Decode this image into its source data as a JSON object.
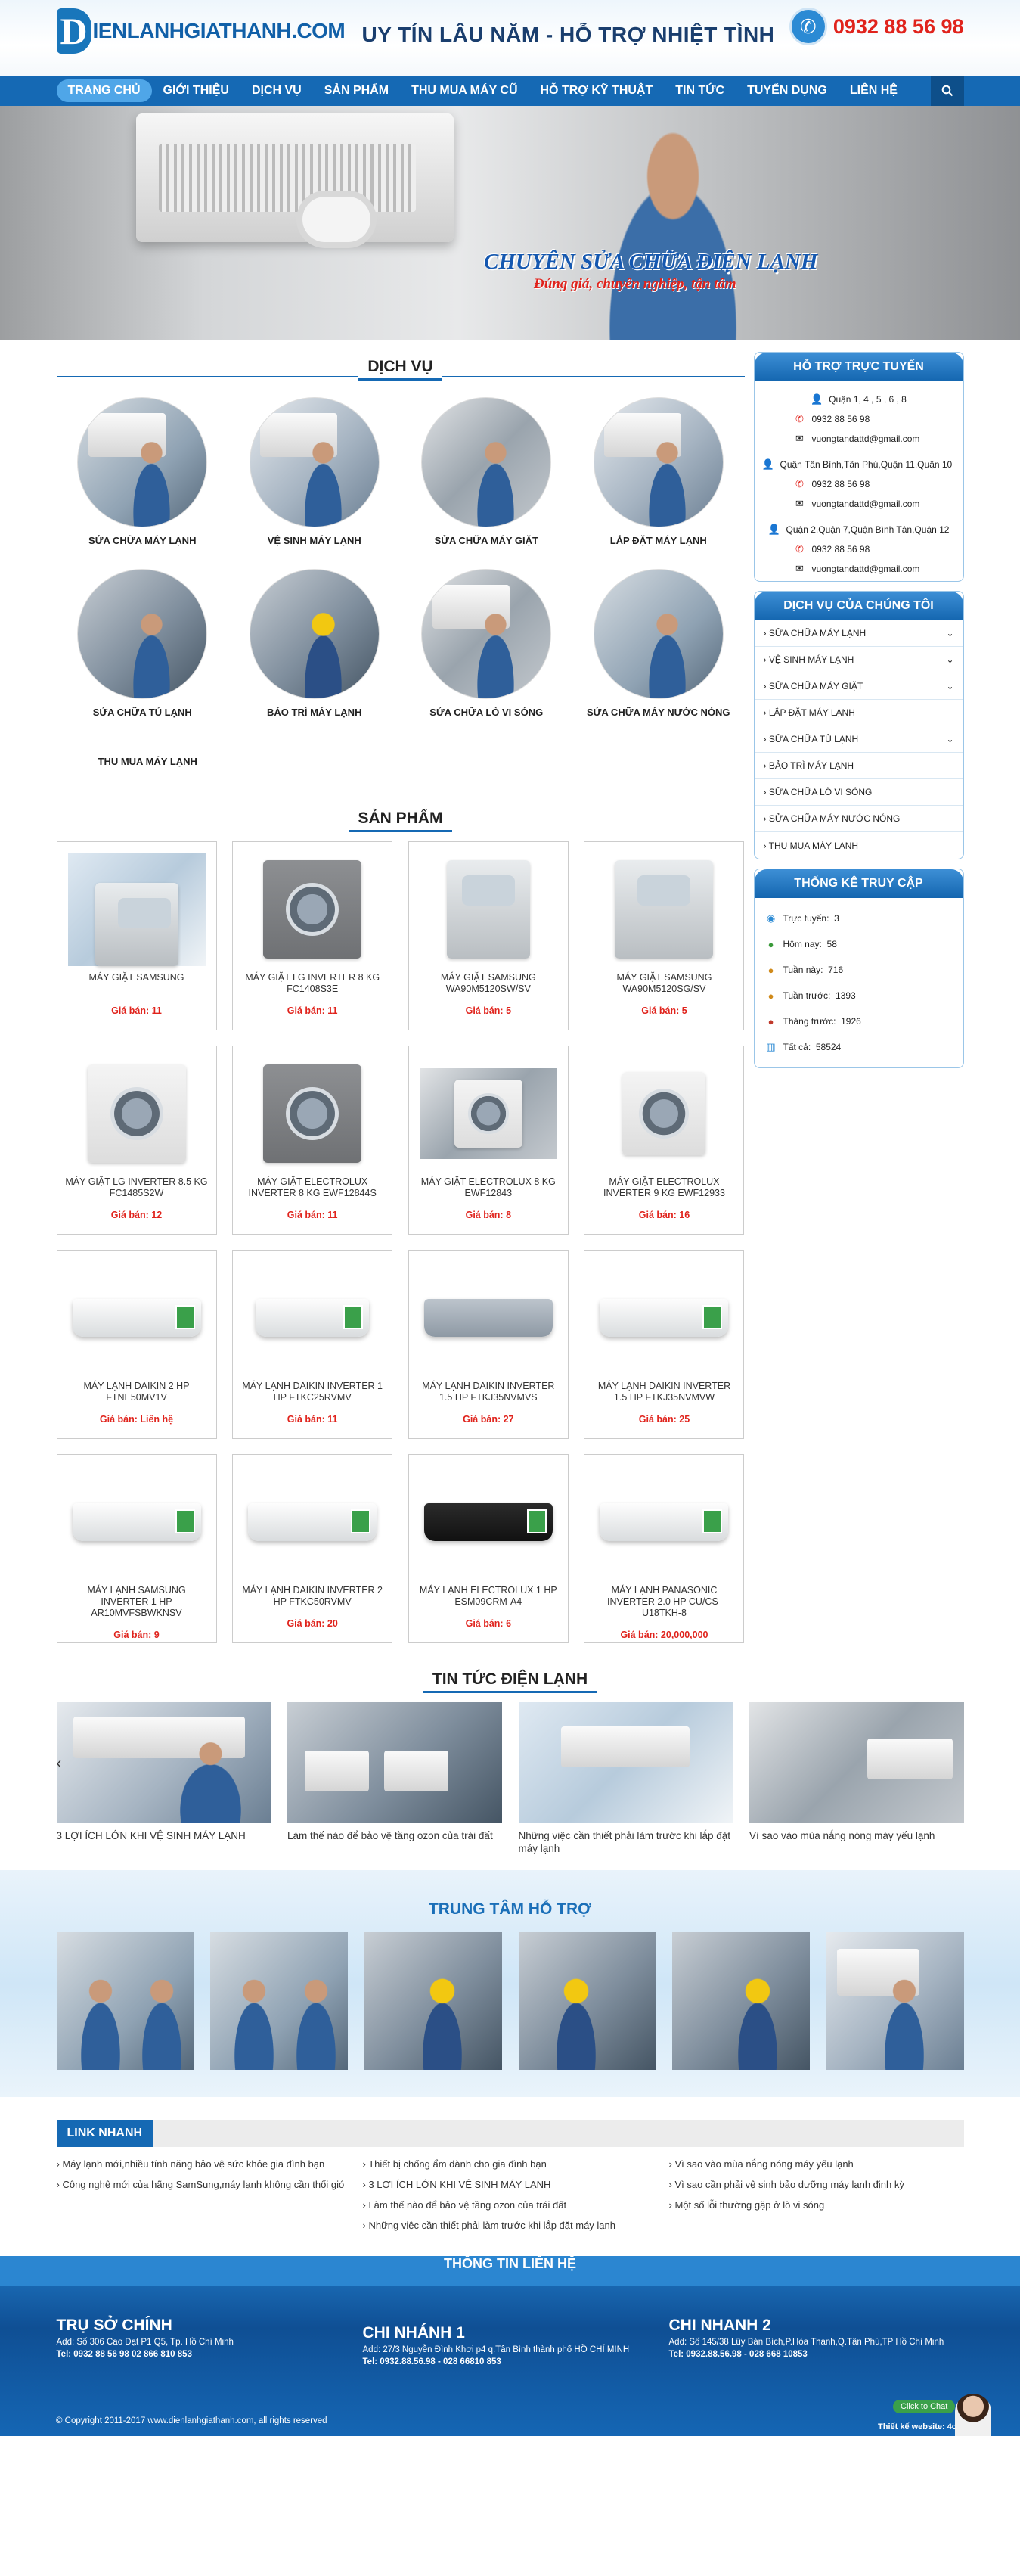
{
  "header": {
    "logo_letter": "D",
    "logo_text": "IENLANHGIATHANH.COM",
    "slogan": "UY TÍN LÂU NĂM - HỖ TRỢ NHIỆT TÌNH",
    "hotline": "0932 88 56 98"
  },
  "nav": {
    "items": [
      "TRANG CHỦ",
      "GIỚI THIỆU",
      "DỊCH VỤ",
      "SẢN PHẨM",
      "THU MUA MÁY CŨ",
      "HỖ TRỢ KỸ THUẬT",
      "TIN TỨC",
      "TUYỂN DỤNG",
      "LIÊN HỆ"
    ]
  },
  "banner": {
    "title": "CHUYÊN SỬA CHỮA ĐIỆN LẠNH",
    "subtitle": "Đúng giá, chuyên nghiệp, tận tâm"
  },
  "services": {
    "title": "DỊCH VỤ",
    "items": [
      "SỬA CHỮA MÁY LẠNH",
      "VỆ SINH MÁY LẠNH",
      "SỬA CHỮA MÁY GIẶT",
      "LẮP ĐẶT MÁY LẠNH",
      "SỬA CHỮA TỦ LẠNH",
      "BẢO TRÌ MÁY LẠNH",
      "SỬA CHỮA LÒ VI SÓNG",
      "SỬA CHỮA MÁY NƯỚC NÓNG"
    ],
    "extra": "THU MUA MÁY LẠNH"
  },
  "products": {
    "title": "SẢN PHẨM",
    "items": [
      {
        "name": "MÁY GIẶT SAMSUNG",
        "price": "Giá bán: 11"
      },
      {
        "name": "MÁY GIẶT LG INVERTER 8 KG FC1408S3E",
        "price": "Giá bán: 11"
      },
      {
        "name": "MÁY GIẶT SAMSUNG WA90M5120SW/SV",
        "price": "Giá bán: 5"
      },
      {
        "name": "MÁY GIẶT SAMSUNG WA90M5120SG/SV",
        "price": "Giá bán: 5"
      },
      {
        "name": "MÁY GIẶT LG INVERTER 8.5 KG FC1485S2W",
        "price": "Giá bán: 12"
      },
      {
        "name": "MÁY GIẶT ELECTROLUX INVERTER 8 KG EWF12844S",
        "price": "Giá bán: 11"
      },
      {
        "name": "MÁY GIẶT ELECTROLUX 8 KG EWF12843",
        "price": "Giá bán: 8"
      },
      {
        "name": "MÁY GIẶT ELECTROLUX INVERTER 9 KG EWF12933",
        "price": "Giá bán: 16"
      },
      {
        "name": "MÁY LẠNH DAIKIN 2 HP FTNE50MV1V",
        "price": "Giá bán: Liên hệ"
      },
      {
        "name": "MÁY LẠNH DAIKIN INVERTER 1 HP FTKC25RVMV",
        "price": "Giá bán: 11"
      },
      {
        "name": "MÁY LẠNH DAIKIN INVERTER 1.5 HP FTKJ35NVMVS",
        "price": "Giá bán: 27"
      },
      {
        "name": "MÁY LẠNH DAIKIN INVERTER 1.5 HP FTKJ35NVMVW",
        "price": "Giá bán: 25"
      },
      {
        "name": "MÁY LẠNH SAMSUNG INVERTER 1 HP AR10MVFSBWKNSV",
        "price": "Giá bán: 9"
      },
      {
        "name": "MÁY LẠNH DAIKIN INVERTER 2 HP FTKC50RVMV",
        "price": "Giá bán: 20"
      },
      {
        "name": "MÁY LẠNH ELECTROLUX 1 HP ESM09CRM-A4",
        "price": "Giá bán: 6"
      },
      {
        "name": "MÁY LẠNH PANASONIC INVERTER 2.0 HP CU/CS-U18TKH-8",
        "price": "Giá bán: 20,000,000"
      }
    ]
  },
  "sidebar": {
    "support_title": "HỖ TRỢ TRỰC TUYẾN",
    "support": [
      {
        "area": "Quận 1, 4 , 5 , 6 , 8",
        "phone": "0932 88 56 98",
        "email": "vuongtandattd@gmail.com"
      },
      {
        "area": "Quận Tân Bình,Tân Phú,Quận 11,Quận 10",
        "phone": "0932 88 56 98",
        "email": "vuongtandattd@gmail.com"
      },
      {
        "area": "Quận 2,Quận 7,Quận Bình Tân,Quận 12",
        "phone": "0932 88 56 98",
        "email": "vuongtandattd@gmail.com"
      }
    ],
    "services_title": "DỊCH VỤ CỦA CHÚNG TÔI",
    "menu": [
      {
        "label": "SỬA CHỮA MÁY LẠNH",
        "has_sub": true
      },
      {
        "label": "VỆ SINH MÁY LẠNH",
        "has_sub": true
      },
      {
        "label": "SỬA CHỮA MÁY GIẶT",
        "has_sub": true
      },
      {
        "label": "LẮP ĐẶT MÁY LẠNH",
        "has_sub": false
      },
      {
        "label": "SỬA CHỮA TỦ LẠNH",
        "has_sub": true
      },
      {
        "label": "BẢO TRÌ MÁY LẠNH",
        "has_sub": false
      },
      {
        "label": "SỬA CHỮA LÒ VI SÓNG",
        "has_sub": false
      },
      {
        "label": "SỬA CHỮA MÁY NƯỚC NÓNG",
        "has_sub": false
      },
      {
        "label": "THU MUA MÁY LẠNH",
        "has_sub": false
      }
    ],
    "stats_title": "THỐNG KÊ TRUY CẬP",
    "stats": [
      {
        "label": "Trực tuyến:",
        "value": "3",
        "icon": "globe-icon"
      },
      {
        "label": "Hôm nay:",
        "value": "58",
        "icon": "user-icon"
      },
      {
        "label": "Tuần này:",
        "value": "716",
        "icon": "users-icon"
      },
      {
        "label": "Tuần trước:",
        "value": "1393",
        "icon": "users-icon"
      },
      {
        "label": "Tháng trước:",
        "value": "1926",
        "icon": "users-icon"
      },
      {
        "label": "Tất cả:",
        "value": "58524",
        "icon": "chart-icon"
      }
    ]
  },
  "news": {
    "title": "TIN TỨC ĐIỆN LẠNH",
    "items": [
      "3 LỢI ÍCH LỚN KHI VỆ SINH MÁY LẠNH",
      "Làm thế nào để bảo vệ tầng ozon của trái đất",
      "Những việc cần thiết phải làm trước khi lắp đặt máy lạnh",
      "Vì sao vào mùa nắng nóng máy yếu lạnh"
    ]
  },
  "center": {
    "title": "TRUNG TÂM HỖ TRỢ"
  },
  "links": {
    "title": "LINK NHANH",
    "col1": [
      "Máy lạnh mới,nhiều tính năng bảo vệ sức khỏe gia đình bạn",
      "Công nghệ mới của hãng SamSung,máy lạnh không cần thổi gió"
    ],
    "col2": [
      "Thiết bị chống ẩm dành cho gia đình bạn",
      "3 LỢI ÍCH LỚN KHI VỆ SINH MÁY LẠNH",
      "Làm thế nào để bảo vệ tầng ozon của trái đất",
      "Những việc cần thiết phải làm trước khi lắp đặt máy lạnh"
    ],
    "col3": [
      "Vì sao vào mùa nắng nóng máy yếu lạnh",
      "Vì sao cần phải vệ sinh bảo dưỡng máy lạnh định kỳ",
      "Một số lỗi thường gặp ở lò vi sóng"
    ]
  },
  "footer": {
    "title": "THÔNG TIN LIÊN HỆ",
    "branches": [
      {
        "name": "TRỤ SỞ CHÍNH",
        "addr": "Add: Số 306 Cao Đạt P1 Q5, Tp. Hồ Chí Minh",
        "tel": "Tel:       0932 88 56 98        02 866 810 853"
      },
      {
        "name": "CHI NHÁNH 1",
        "addr": "Add: 27/3 Nguyễn Đình Khơi p4 q.Tân Bình thành phố HỒ CHÍ MINH",
        "tel": "Tel: 0932.88.56.98  -  028 66810 853"
      },
      {
        "name": "CHI NHANH 2",
        "addr": "Add: Số 145/38 Lũy Bán Bích,P.Hòa Thạnh,Q.Tân Phú,TP Hồ Chí Minh",
        "tel": "Tel: 0932.88.56.98  -  028 668 10853"
      }
    ],
    "copyright": "© Copyright 2011-2017 www.dienlanhgiathanh.com, all rights reserved",
    "chat_button": "Click to Chat",
    "chat_text": "Thiết kế website: 4c"
  }
}
